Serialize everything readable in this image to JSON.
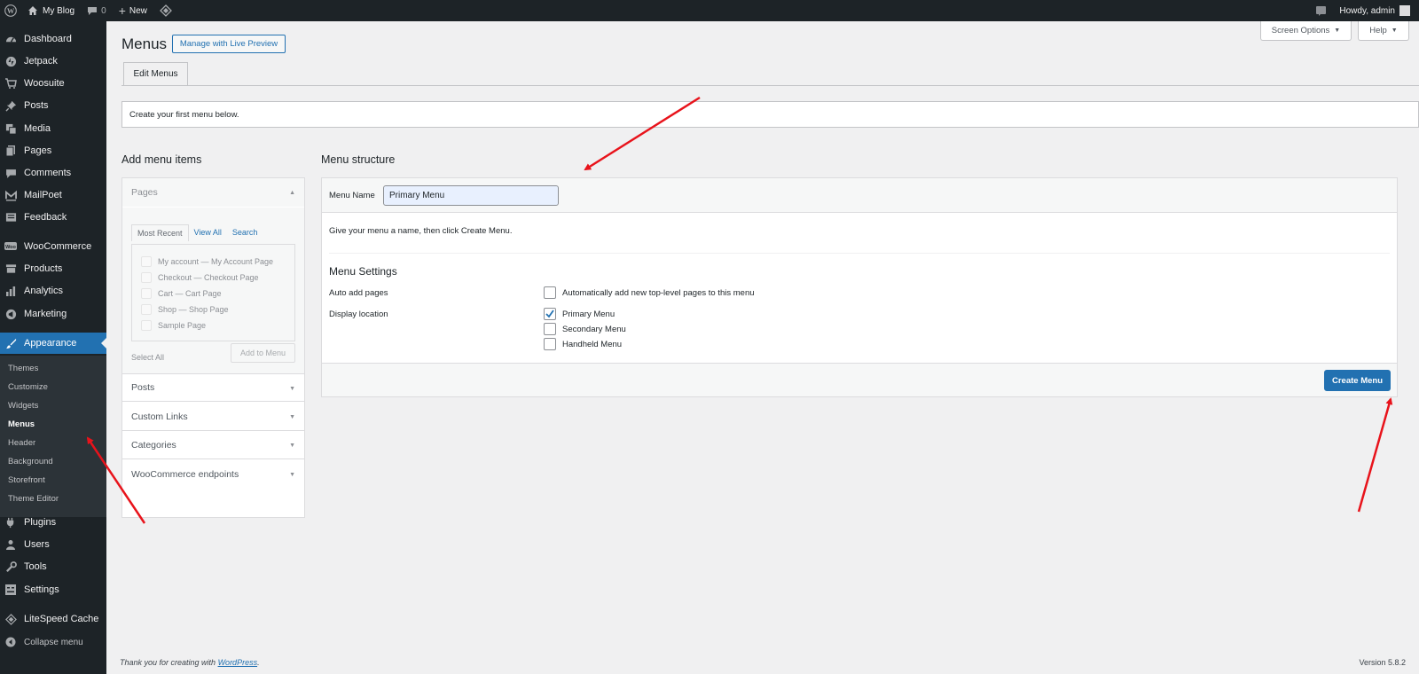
{
  "admin_bar": {
    "site_name": "My Blog",
    "comments_count": "0",
    "new_label": "New",
    "howdy": "Howdy, admin"
  },
  "sidebar": {
    "items": [
      {
        "label": "Dashboard",
        "icon": "dashboard-icon"
      },
      {
        "label": "Jetpack",
        "icon": "jetpack-icon"
      },
      {
        "label": "Woosuite",
        "icon": "woosuite-icon"
      },
      {
        "label": "Posts",
        "icon": "pin-icon"
      },
      {
        "label": "Media",
        "icon": "media-icon"
      },
      {
        "label": "Pages",
        "icon": "pages-icon"
      },
      {
        "label": "Comments",
        "icon": "comments-icon"
      },
      {
        "label": "MailPoet",
        "icon": "mailpoet-icon"
      },
      {
        "label": "Feedback",
        "icon": "feedback-icon"
      },
      {
        "label": "WooCommerce",
        "icon": "woocommerce-icon"
      },
      {
        "label": "Products",
        "icon": "products-icon"
      },
      {
        "label": "Analytics",
        "icon": "analytics-icon"
      },
      {
        "label": "Marketing",
        "icon": "megaphone-icon"
      },
      {
        "label": "Appearance",
        "icon": "paintbrush-icon"
      },
      {
        "label": "Plugins",
        "icon": "plugins-icon"
      },
      {
        "label": "Users",
        "icon": "users-icon"
      },
      {
        "label": "Tools",
        "icon": "tools-icon"
      },
      {
        "label": "Settings",
        "icon": "settings-icon"
      },
      {
        "label": "LiteSpeed Cache",
        "icon": "litespeed-icon"
      },
      {
        "label": "Collapse menu",
        "icon": "collapse-icon"
      }
    ],
    "submenu": [
      "Themes",
      "Customize",
      "Widgets",
      "Menus",
      "Header",
      "Background",
      "Storefront",
      "Theme Editor"
    ]
  },
  "header": {
    "title": "Menus",
    "live_preview": "Manage with Live Preview",
    "screen_options": "Screen Options",
    "help": "Help"
  },
  "tab": {
    "edit_menus": "Edit Menus"
  },
  "notice": "Create your first menu below.",
  "add_items": {
    "heading": "Add menu items",
    "pages_section": "Pages",
    "tabs": [
      "Most Recent",
      "View All",
      "Search"
    ],
    "pages": [
      "My account — My Account Page",
      "Checkout — Checkout Page",
      "Cart — Cart Page",
      "Shop — Shop Page",
      "Sample Page"
    ],
    "select_all": "Select All",
    "add_to_menu": "Add to Menu",
    "sections": [
      "Posts",
      "Custom Links",
      "Categories",
      "WooCommerce endpoints"
    ]
  },
  "structure": {
    "heading": "Menu structure",
    "menu_name_label": "Menu Name",
    "menu_name_value": "Primary Menu",
    "instructions": "Give your menu a name, then click Create Menu.",
    "settings_heading": "Menu Settings",
    "auto_add_label": "Auto add pages",
    "auto_add_option": "Automatically add new top-level pages to this menu",
    "display_location_label": "Display location",
    "locations": [
      {
        "label": "Primary Menu",
        "checked": true
      },
      {
        "label": "Secondary Menu",
        "checked": false
      },
      {
        "label": "Handheld Menu",
        "checked": false
      }
    ],
    "create_button": "Create Menu"
  },
  "footer": {
    "thanks_prefix": "Thank you for creating with ",
    "wordpress_link": "WordPress",
    "thanks_suffix": ".",
    "version": "Version 5.8.2"
  },
  "colors": {
    "accent": "#2271b1",
    "adminbar": "#1d2327",
    "annotation_arrow": "#e8131b"
  }
}
